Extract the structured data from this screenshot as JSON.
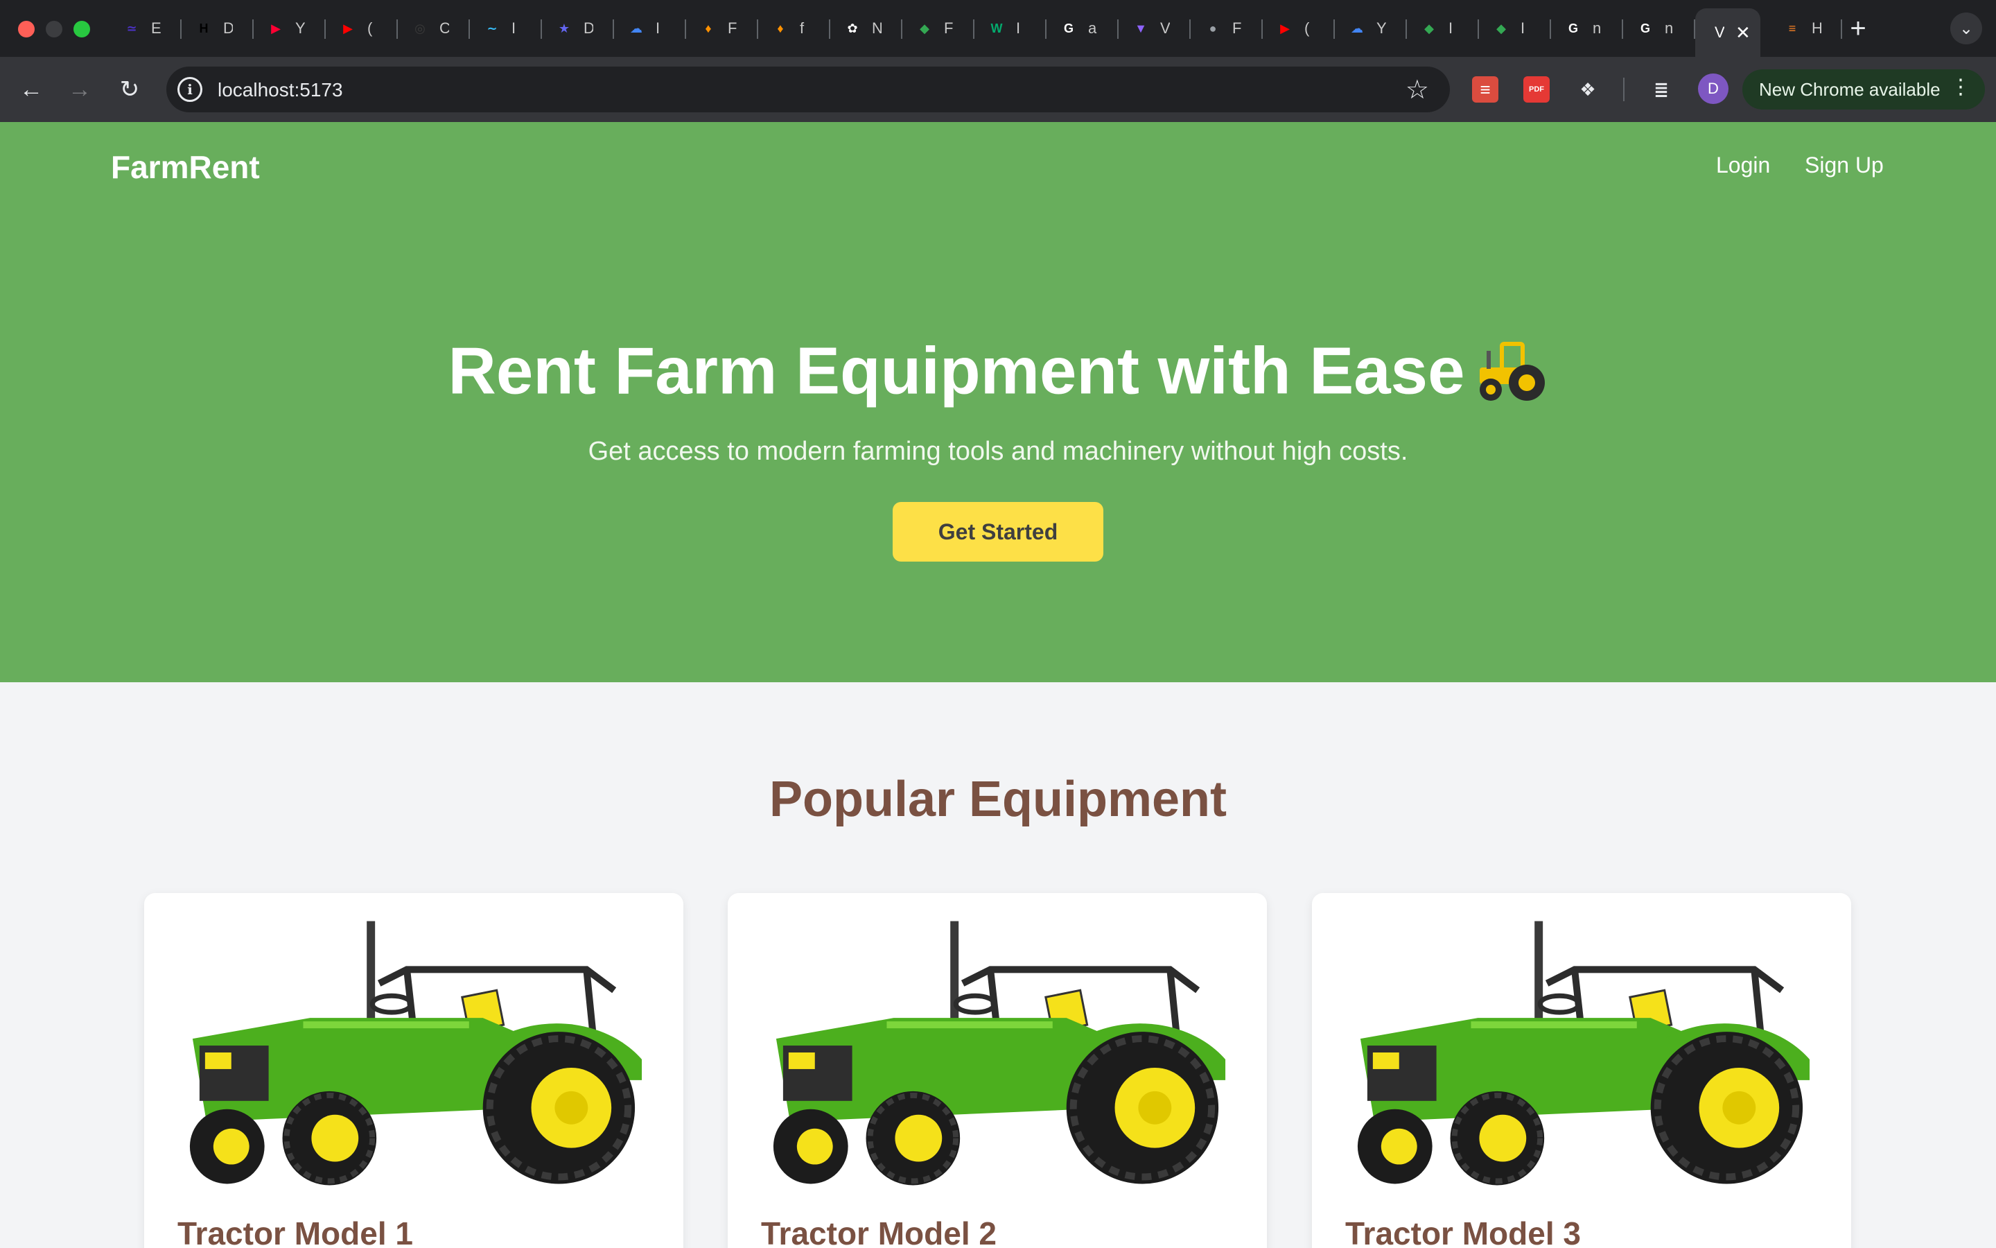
{
  "browser": {
    "tabs": [
      {
        "initial": "E",
        "icon": "eslint-icon",
        "color": "#4b32c3",
        "glyph": "≃"
      },
      {
        "initial": "D",
        "icon": "hackernoon-icon",
        "color": "#000000",
        "glyph": "H"
      },
      {
        "initial": "Y",
        "icon": "youtube-music-icon",
        "color": "#ff0033",
        "glyph": "▶"
      },
      {
        "initial": "(",
        "icon": "youtube-icon",
        "color": "#ff0000",
        "glyph": "▶"
      },
      {
        "initial": "C",
        "icon": "circle-logo-icon",
        "color": "#3a3a3a",
        "glyph": "◎"
      },
      {
        "initial": "I",
        "icon": "tailwind-icon",
        "color": "#38bdf8",
        "glyph": "∼"
      },
      {
        "initial": "D",
        "icon": "devtool-icon",
        "color": "#6366f1",
        "glyph": "★"
      },
      {
        "initial": "I",
        "icon": "google-cloud-icon",
        "color": "#4285f4",
        "glyph": "☁"
      },
      {
        "initial": "F",
        "icon": "firebase-icon",
        "color": "#ff9100",
        "glyph": "♦"
      },
      {
        "initial": "f",
        "icon": "firebase-icon",
        "color": "#ff9100",
        "glyph": "♦"
      },
      {
        "initial": "N",
        "icon": "openai-icon",
        "color": "#ffffff",
        "glyph": "✿"
      },
      {
        "initial": "F",
        "icon": "map-app-icon",
        "color": "#34a853",
        "glyph": "◆"
      },
      {
        "initial": "I",
        "icon": "w3schools-icon",
        "color": "#04aa6d",
        "glyph": "W"
      },
      {
        "initial": "a",
        "icon": "google-icon",
        "color": "#ffffff",
        "glyph": "G"
      },
      {
        "initial": "V",
        "icon": "vite-icon",
        "color": "#8e63ff",
        "glyph": "▼"
      },
      {
        "initial": "F",
        "icon": "globe-icon",
        "color": "#9aa0a6",
        "glyph": "●"
      },
      {
        "initial": "(",
        "icon": "youtube-icon",
        "color": "#ff0000",
        "glyph": "▶"
      },
      {
        "initial": "Y",
        "icon": "google-cloud-icon",
        "color": "#4285f4",
        "glyph": "☁"
      },
      {
        "initial": "I",
        "icon": "map-app-icon",
        "color": "#34a853",
        "glyph": "◆"
      },
      {
        "initial": "I",
        "icon": "map-app-icon",
        "color": "#34a853",
        "glyph": "◆"
      },
      {
        "initial": "n",
        "icon": "google-icon",
        "color": "#ffffff",
        "glyph": "G"
      },
      {
        "initial": "n",
        "icon": "google-icon",
        "color": "#ffffff",
        "glyph": "G"
      }
    ],
    "active_tab": {
      "initial": "V",
      "close": "✕"
    },
    "after_tab": {
      "initial": "H",
      "icon": "stackoverflow-icon",
      "color": "#f48024",
      "glyph": "≡"
    },
    "new_tab": "+",
    "tab_search": "⌄",
    "back": "←",
    "forward": "→",
    "reload": "↻",
    "site_info": "i",
    "url": "localhost:5173",
    "bookmark_star": "☆",
    "extensions": [
      {
        "icon": "todoist-icon",
        "color": "#db4c3f",
        "glyph": "≡"
      },
      {
        "icon": "pdf-icon",
        "color": "#e53935",
        "glyph": "PDF"
      },
      {
        "icon": "puzzle-extensions-icon",
        "color": "transparent",
        "glyph": "❖"
      },
      {
        "icon": "media-queue-icon",
        "color": "transparent",
        "glyph": "≣"
      }
    ],
    "profile_initial": "D",
    "update_label": "New Chrome available",
    "menu_dots": "⋮"
  },
  "page": {
    "brand": "FarmRent",
    "nav": {
      "login": "Login",
      "signup": "Sign Up"
    },
    "hero": {
      "title": "Rent Farm Equipment with Ease",
      "subtitle": "Get access to modern farming tools and machinery without high costs.",
      "cta": "Get Started"
    },
    "section_title": "Popular Equipment",
    "equipment": [
      {
        "name": "Tractor Model 1"
      },
      {
        "name": "Tractor Model 2"
      },
      {
        "name": "Tractor Model 3"
      }
    ],
    "colors": {
      "hero_green": "#68ae5c",
      "cta_yellow": "#fde047",
      "heading_brown": "#7a5142",
      "tractor_green": "#4caf1e",
      "tractor_yellow": "#f5e11a"
    }
  }
}
